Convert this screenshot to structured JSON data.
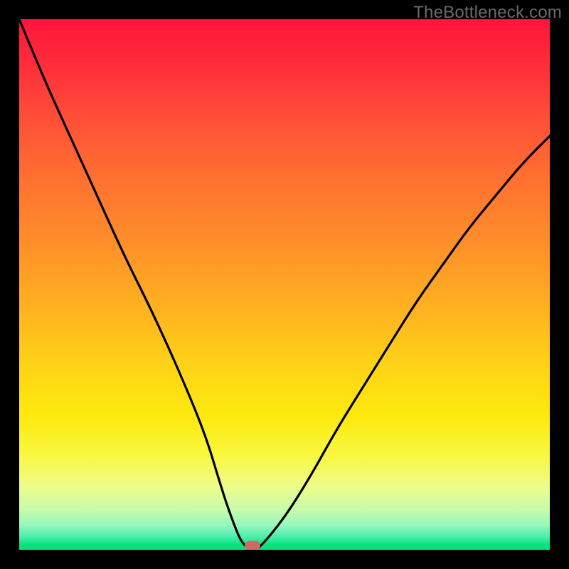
{
  "watermark": "TheBottleneck.com",
  "colors": {
    "frame": "#000000",
    "curve": "#000000",
    "marker": "#cf6a62",
    "watermark": "#6a6a6a"
  },
  "chart_data": {
    "type": "line",
    "title": "",
    "xlabel": "",
    "ylabel": "",
    "xlim": [
      0,
      100
    ],
    "ylim": [
      0,
      100
    ],
    "series": [
      {
        "name": "bottleneck-curve",
        "x": [
          0,
          5,
          10,
          15,
          20,
          25,
          30,
          35,
          38,
          40,
          42,
          44,
          45,
          50,
          55,
          60,
          65,
          70,
          75,
          80,
          85,
          90,
          95,
          100
        ],
        "values": [
          100,
          88,
          77,
          66,
          55,
          45,
          34,
          22,
          12,
          6,
          1,
          0,
          0,
          6,
          14,
          23,
          31,
          39,
          47,
          54,
          61,
          67,
          73,
          78
        ]
      }
    ],
    "annotations": [
      {
        "name": "min-marker",
        "x": 44,
        "y": 0
      }
    ],
    "background_gradient": {
      "direction": "vertical",
      "stops": [
        {
          "pos": 0.0,
          "color": "#ff153c"
        },
        {
          "pos": 0.3,
          "color": "#ff7030"
        },
        {
          "pos": 0.66,
          "color": "#ffd516"
        },
        {
          "pos": 0.88,
          "color": "#eefc8a"
        },
        {
          "pos": 1.0,
          "color": "#02df77"
        }
      ]
    }
  }
}
